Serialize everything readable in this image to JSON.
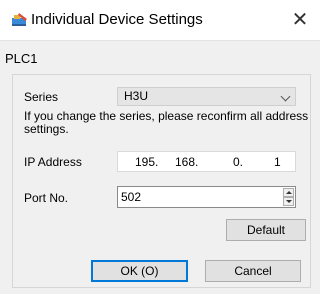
{
  "window": {
    "title": "Individual Device Settings",
    "close_icon": "close-icon",
    "app_icon": "settings-app-icon"
  },
  "device": {
    "name": "PLC1"
  },
  "form": {
    "series_label": "Series",
    "series_value": "H3U",
    "series_note": "If you change the series, please reconfirm all address settings.",
    "ip_label": "IP Address",
    "ip_octets": [
      "195.",
      "168.",
      "0.",
      "1"
    ],
    "port_label": "Port No.",
    "port_value": "502"
  },
  "buttons": {
    "default": "Default",
    "ok": "OK (O)",
    "cancel": "Cancel"
  }
}
